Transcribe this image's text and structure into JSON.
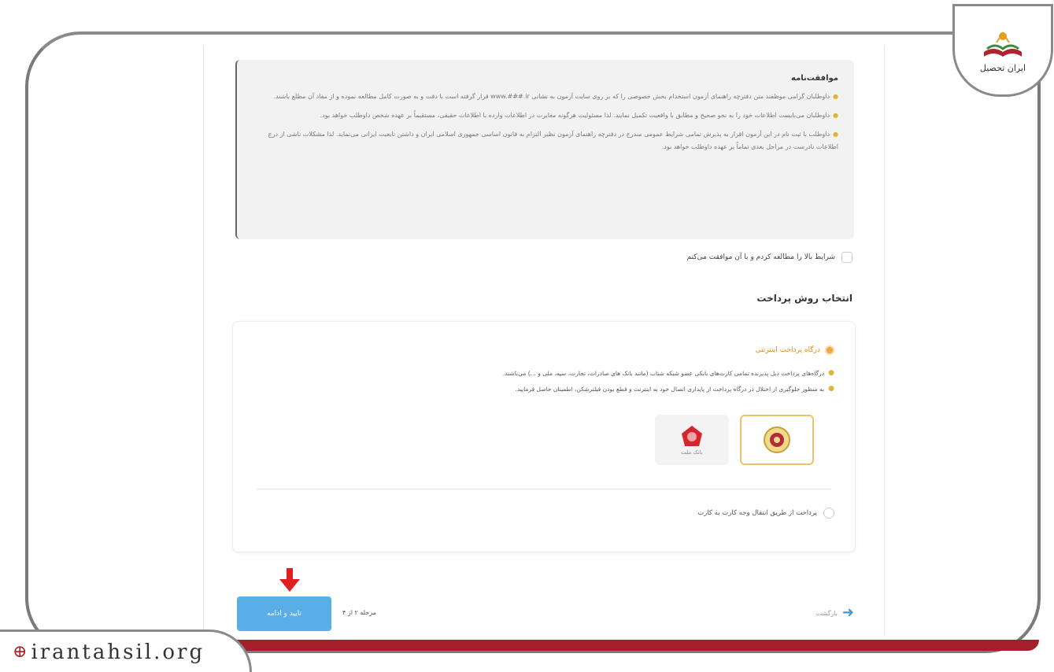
{
  "brand": {
    "logo_text": "ایران تحصیل",
    "watermark": "irantahsil.org"
  },
  "agreement": {
    "title": "موافقت‌نامه",
    "items": [
      "داوطلبان گرامی موظفند متن دفترچه راهنمای آزمون استخدام بخش خصوصی را که بر روی سایت آزمون به نشانی www.###.ir قرار گرفته است با دقت و به صورت کامل مطالعه نموده و از مفاد آن مطلع باشند.",
      "داوطلبان می‌بایست اطلاعات خود را به نحو صحیح و مطابق با واقعیت تکمیل نمایند. لذا مسئولیت هرگونه مغایرت در اطلاعات وارده با اطلاعات حقیقی، مستقیماً بر عهده شخص داوطلب خواهد بود.",
      "داوطلب با ثبت نام در این آزمون اقرار به پذیرش تمامی شرایط عمومی مندرج در دفترچه راهنمای آزمون نظیر التزام به قانون اساسی جمهوری اسلامی ایران و داشتن تابعیت ایرانی می‌نماید. لذا مشکلات ناشی از درج اطلاعات نادرست در مراحل بعدی تماماً بر عهده داوطلب خواهد بود."
    ]
  },
  "accept_label": "شرایط بالا را مطالعه کردم و با آن موافقت می‌کنم",
  "payment": {
    "heading": "انتخاب روش پرداخت",
    "online_label": "درگاه پرداخت اینترنتی",
    "notes": [
      "درگاه‌های پرداخت ذیل پذیرنده تمامی کارت‌های بانکی عضو شبکه شتاب (مانند بانک های صادرات، تجارت، سپه، ملی و ...) می‌باشند.",
      "به منظور جلوگیری از اختلال در درگاه پرداخت از پایداری اتصال خود به اینترنت و قطع بودن فیلترشکن، اطمینان حاصل فرمایید."
    ],
    "banks": [
      "بانک ملی",
      "بانک ملت"
    ],
    "transfer_label": "پرداخت از طریق انتقال وجه کارت به کارت"
  },
  "footer": {
    "confirm_label": "تایید و ادامه",
    "step_text": "مرحله ۲ از ۴",
    "back_label": "بازگشت"
  },
  "colors": {
    "accent_blue": "#5aaee6",
    "online_orange": "#f5a640",
    "brand_red": "#a21f2b",
    "arrow_red": "#e02020"
  }
}
